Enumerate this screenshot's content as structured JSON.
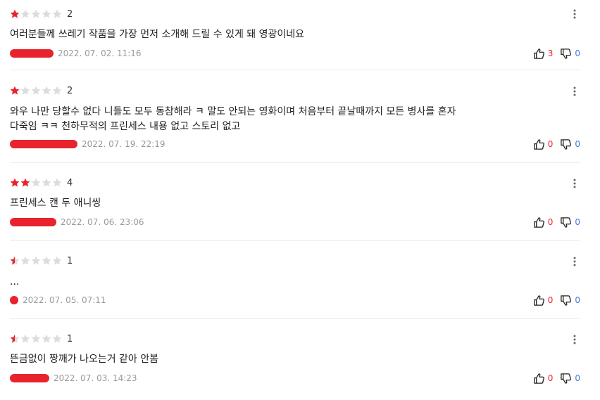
{
  "colors": {
    "star_on": "#e8232e",
    "star_off": "#dcdcdc",
    "like": "#e8232e",
    "dislike": "#3d7be2"
  },
  "icons": {
    "more": "vertical-dots-icon",
    "like": "thumbs-up-icon",
    "dislike": "thumbs-down-icon",
    "star": "star-icon"
  },
  "reviews": [
    {
      "stars": 1,
      "score": "2",
      "text": "여러분들께 쓰레기 작품을 가장 먼저 소개해 드릴 수 있게 돼 영광이네요",
      "date": "2022. 07. 02. 11:16",
      "likes": "3",
      "dislikes": "0"
    },
    {
      "stars": 1,
      "score": "2",
      "text": "와우   나만 당할수 없다 니들도  모두 동참해라 ㅋ  말도 안되는 영화이며 처음부터 끝날때까지 모든 병사를 혼자\n다죽임  ㅋㅋ  천하무적의 프린세스  내용  없고 스토리 없고",
      "date": "2022. 07. 19. 22:19",
      "likes": "0",
      "dislikes": "0"
    },
    {
      "stars": 2,
      "score": "4",
      "text": "프린세스 캔 두 애니씽",
      "date": "2022. 07. 06. 23:06",
      "likes": "0",
      "dislikes": "0"
    },
    {
      "stars": 0.5,
      "score": "1",
      "text": "...",
      "date": "2022. 07. 05. 07:11",
      "likes": "0",
      "dislikes": "0"
    },
    {
      "stars": 0.5,
      "score": "1",
      "text": "뜬금없이 짱깨가 나오는거 같아 안봄",
      "date": "2022. 07. 03. 14:23",
      "likes": "0",
      "dislikes": "0"
    }
  ]
}
